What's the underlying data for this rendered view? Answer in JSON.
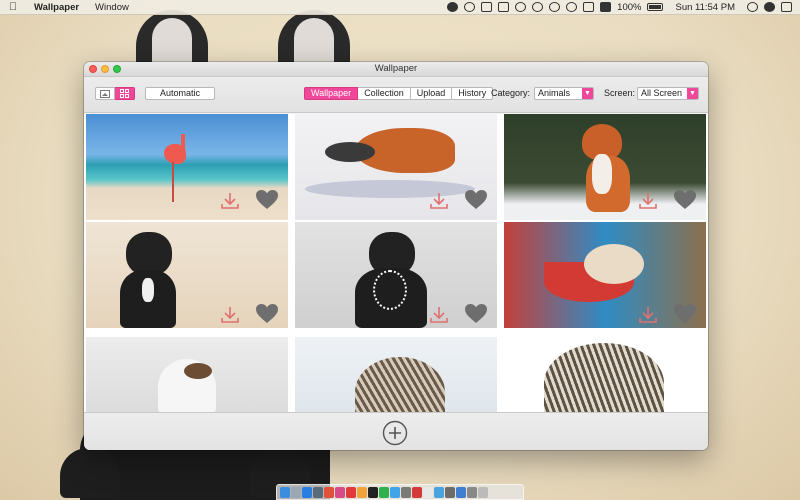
{
  "menubar": {
    "apple_icon": "apple-icon",
    "app_name": "Wallpaper",
    "menu_window": "Window",
    "battery": "100%",
    "clock": "Sun 11:54 PM"
  },
  "window": {
    "title": "Wallpaper"
  },
  "toolbar": {
    "automatic_label": "Automatic",
    "tabs": [
      "Wallpaper",
      "Collection",
      "Upload",
      "History"
    ],
    "active_tab": "Wallpaper",
    "category_label": "Category:",
    "category_value": "Animals",
    "screen_label": "Screen:",
    "screen_value": "All Screen"
  },
  "tiles": [
    {
      "subject": "flamingo on beach",
      "favorite": false
    },
    {
      "subject": "fox in snow",
      "favorite": false
    },
    {
      "subject": "red fox sitting",
      "favorite": false
    },
    {
      "subject": "french bulldog",
      "favorite": false
    },
    {
      "subject": "french bulldog with pearls",
      "favorite": false
    },
    {
      "subject": "mouse in spoon",
      "favorite": false
    },
    {
      "subject": "guinea pig",
      "favorite": false
    },
    {
      "subject": "hedgehog in snow",
      "favorite": false
    },
    {
      "subject": "hedgehog",
      "favorite": false
    }
  ],
  "icons": {
    "download": "download-icon",
    "heart": "heart-icon",
    "add": "plus-circle-icon"
  },
  "colors": {
    "accent": "#f0479b",
    "download_icon": "#e07070",
    "heart_icon": "#6e6e6e"
  }
}
